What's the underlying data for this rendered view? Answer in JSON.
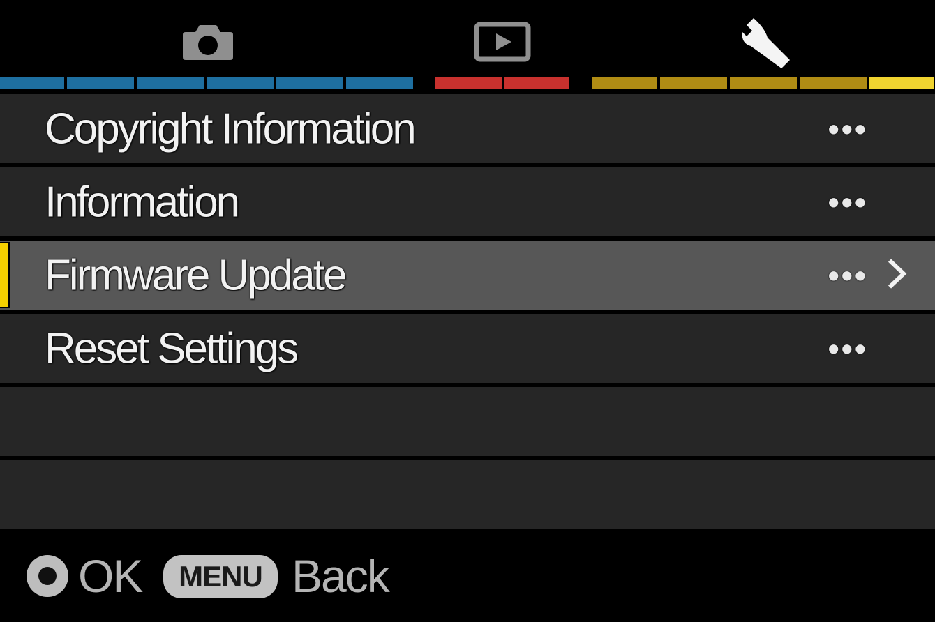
{
  "tabs": [
    {
      "icon": "camera-icon",
      "color": "#1e6fa0",
      "active": false
    },
    {
      "icon": "playback-icon",
      "color": "#c8312e",
      "active": false
    },
    {
      "icon": "wrench-icon",
      "color": "#b08c14",
      "active": true,
      "active_color": "#f0d430"
    }
  ],
  "menu": {
    "items": [
      {
        "label": "Copyright Information",
        "value": "•••",
        "selected": false
      },
      {
        "label": "Information",
        "value": "•••",
        "selected": false
      },
      {
        "label": "Firmware Update",
        "value": "•••",
        "selected": true
      },
      {
        "label": "Reset Settings",
        "value": "•••",
        "selected": false
      }
    ]
  },
  "footer": {
    "ok_label": "OK",
    "menu_key_label": "MENU",
    "back_label": "Back"
  },
  "colors": {
    "row_background": "#262626",
    "row_selected_background": "#575757",
    "selection_marker": "#f5d000"
  }
}
